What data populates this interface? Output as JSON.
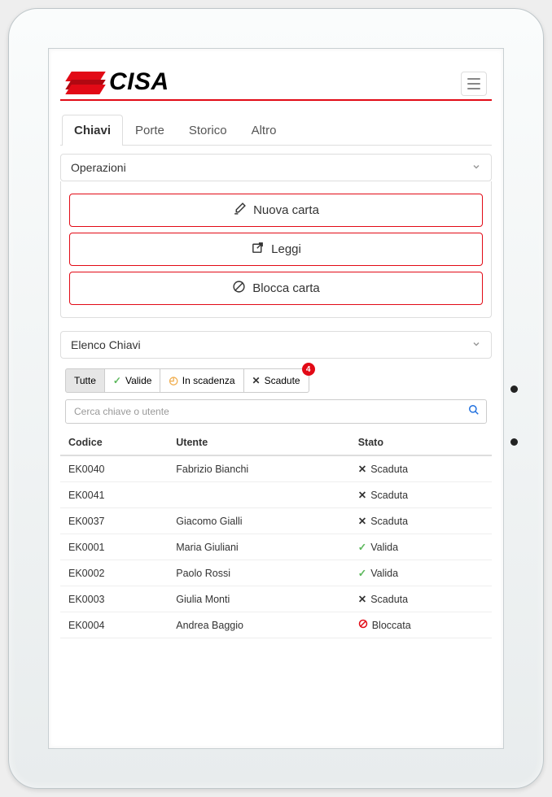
{
  "brand": {
    "name": "CISA"
  },
  "tabs": [
    {
      "label": "Chiavi",
      "active": true
    },
    {
      "label": "Porte"
    },
    {
      "label": "Storico"
    },
    {
      "label": "Altro"
    }
  ],
  "operations": {
    "title": "Operazioni",
    "buttons": {
      "new_card": "Nuova carta",
      "read": "Leggi",
      "block": "Blocca carta"
    }
  },
  "key_list": {
    "title": "Elenco Chiavi",
    "filters": {
      "all": "Tutte",
      "valid": "Valide",
      "expiring": "In scadenza",
      "expired": "Scadute",
      "expired_badge": "4"
    },
    "search_placeholder": "Cerca chiave o utente",
    "headers": {
      "code": "Codice",
      "user": "Utente",
      "status": "Stato"
    },
    "rows": [
      {
        "code": "EK0040",
        "user": "Fabrizio Bianchi",
        "status": "Scaduta",
        "status_kind": "expired"
      },
      {
        "code": "EK0041",
        "user": "",
        "status": "Scaduta",
        "status_kind": "expired"
      },
      {
        "code": "EK0037",
        "user": "Giacomo Gialli",
        "status": "Scaduta",
        "status_kind": "expired"
      },
      {
        "code": "EK0001",
        "user": "Maria Giuliani",
        "status": "Valida",
        "status_kind": "valid"
      },
      {
        "code": "EK0002",
        "user": "Paolo Rossi",
        "status": "Valida",
        "status_kind": "valid"
      },
      {
        "code": "EK0003",
        "user": "Giulia Monti",
        "status": "Scaduta",
        "status_kind": "expired"
      },
      {
        "code": "EK0004",
        "user": "Andrea Baggio",
        "status": "Bloccata",
        "status_kind": "blocked"
      }
    ]
  }
}
